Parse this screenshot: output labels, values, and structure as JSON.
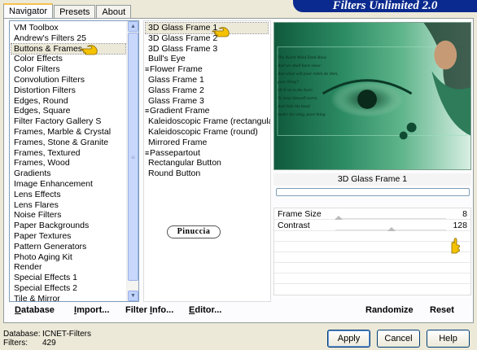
{
  "header": {
    "tabs": [
      {
        "label": "Navigator",
        "active": true
      },
      {
        "label": "Presets",
        "active": false
      },
      {
        "label": "About",
        "active": false
      }
    ],
    "banner": "Filters Unlimited 2.0"
  },
  "categories": {
    "items": [
      "VM Toolbox",
      "Andrew's Filters 25",
      "Buttons & Frames",
      "Color Effects",
      "Color Filters",
      "Convolution Filters",
      "Distortion Filters",
      "Edges, Round",
      "Edges, Square",
      "Filter Factory Gallery S",
      "Frames, Marble & Crystal",
      "Frames, Stone & Granite",
      "Frames, Textured",
      "Frames, Wood",
      "Gradients",
      "Image Enhancement",
      "Lens Effects",
      "Lens Flares",
      "Noise Filters",
      "Paper Backgrounds",
      "Paper Textures",
      "Pattern Generators",
      "Photo Aging Kit",
      "Render",
      "Special Effects 1",
      "Special Effects 2",
      "Tile & Mirror"
    ],
    "selected": "Buttons & Frames"
  },
  "filters": {
    "items": [
      {
        "label": "3D Glass Frame 1",
        "group": false
      },
      {
        "label": "3D Glass Frame 2",
        "group": false
      },
      {
        "label": "3D Glass Frame 3",
        "group": false
      },
      {
        "label": "Bull's Eye",
        "group": false
      },
      {
        "label": "Flower Frame",
        "group": true
      },
      {
        "label": "Glass Frame 1",
        "group": false
      },
      {
        "label": "Glass Frame 2",
        "group": false
      },
      {
        "label": "Glass Frame 3",
        "group": false
      },
      {
        "label": "Gradient Frame",
        "group": true
      },
      {
        "label": "Kaleidoscopic Frame (rectangular)",
        "group": false
      },
      {
        "label": "Kaleidoscopic Frame (round)",
        "group": false
      },
      {
        "label": "Mirrored Frame",
        "group": false
      },
      {
        "label": "Passepartout",
        "group": true
      },
      {
        "label": "Rectangular Button",
        "group": false
      },
      {
        "label": "Round Button",
        "group": false
      }
    ],
    "selected": "3D Glass Frame 1"
  },
  "watermark": "Pinuccia",
  "preview": {
    "poem_lines": [
      "The North Wind Doth Blow",
      "And we shall have snow",
      "And what will poor robin do then,",
      "poor thing?",
      "He'll sit in the barn",
      "To keep himself warm,",
      "And hide his head",
      "under his wing, poor thing."
    ]
  },
  "current_filter": "3D Glass Frame 1",
  "progress": 0,
  "params": [
    {
      "label": "Frame Size",
      "value": "8",
      "level": 0.03
    },
    {
      "label": "Contrast",
      "value": "128",
      "level": 0.5
    }
  ],
  "bottom_links": {
    "database": "Database",
    "import": "Import...",
    "filter_info": "Filter Info...",
    "editor": "Editor...",
    "randomize": "Randomize",
    "reset": "Reset"
  },
  "status": {
    "database_label": "Database:",
    "database_value": "ICNET-Filters",
    "filters_label": "Filters:",
    "filters_value": "429"
  },
  "buttons": {
    "apply": "Apply",
    "cancel": "Cancel",
    "help": "Help"
  },
  "colors": {
    "hand": "#d4a000",
    "selection": "#ece9d8",
    "banner": "#0b2a8f"
  },
  "icons": {
    "pointer": "pointing-hand-icon"
  }
}
